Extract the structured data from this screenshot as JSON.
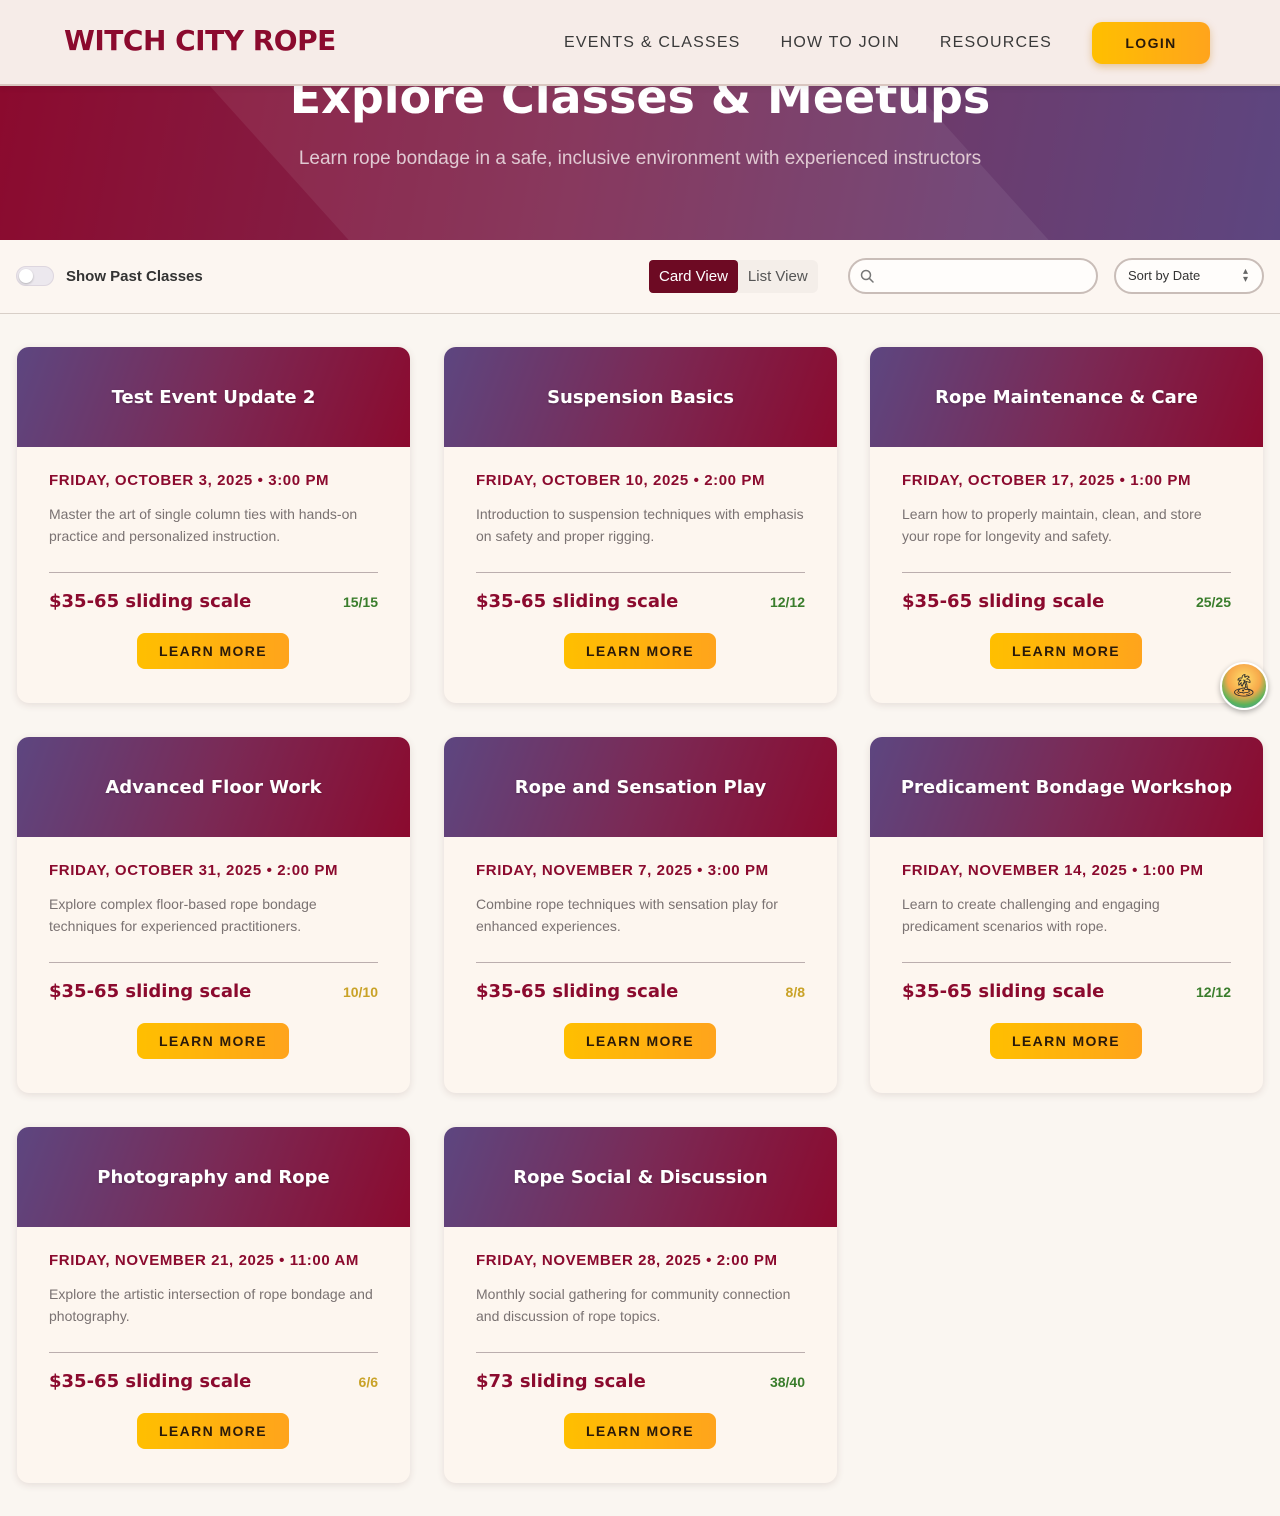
{
  "header": {
    "logo": "WITCH CITY ROPE",
    "nav": [
      "EVENTS & CLASSES",
      "HOW TO JOIN",
      "RESOURCES"
    ],
    "login_label": "LOGIN"
  },
  "hero": {
    "title": "Explore Classes & Meetups",
    "subtitle": "Learn rope bondage in a safe, inclusive environment with experienced instructors"
  },
  "filters": {
    "toggle_label": "Show Past Classes",
    "toggle_on": false,
    "card_view_label": "Card View",
    "list_view_label": "List View",
    "active_view": "Card View",
    "search_value": "",
    "sort_label": "Sort by Date"
  },
  "colors": {
    "brand": "#8b0a2e",
    "accent": "#ffbf00",
    "capacity_full": "#3a7d2c",
    "capacity_partial": "#c9a227"
  },
  "events": [
    {
      "title": "Test Event Update 2",
      "date": "FRIDAY, OCTOBER 3, 2025 • 3:00 PM",
      "description": "Master the art of single column ties with hands-on practice and personalized instruction.",
      "price": "$35-65 sliding scale",
      "capacity": "15/15",
      "capacity_color": "green",
      "button": "LEARN MORE"
    },
    {
      "title": "Suspension Basics",
      "date": "FRIDAY, OCTOBER 10, 2025 • 2:00 PM",
      "description": "Introduction to suspension techniques with emphasis on safety and proper rigging.",
      "price": "$35-65 sliding scale",
      "capacity": "12/12",
      "capacity_color": "green",
      "button": "LEARN MORE"
    },
    {
      "title": "Rope Maintenance & Care",
      "date": "FRIDAY, OCTOBER 17, 2025 • 1:00 PM",
      "description": "Learn how to properly maintain, clean, and store your rope for longevity and safety.",
      "price": "$35-65 sliding scale",
      "capacity": "25/25",
      "capacity_color": "green",
      "button": "LEARN MORE"
    },
    {
      "title": "Advanced Floor Work",
      "date": "FRIDAY, OCTOBER 31, 2025 • 2:00 PM",
      "description": "Explore complex floor-based rope bondage techniques for experienced practitioners.",
      "price": "$35-65 sliding scale",
      "capacity": "10/10",
      "capacity_color": "gold",
      "button": "LEARN MORE"
    },
    {
      "title": "Rope and Sensation Play",
      "date": "FRIDAY, NOVEMBER 7, 2025 • 3:00 PM",
      "description": "Combine rope techniques with sensation play for enhanced experiences.",
      "price": "$35-65 sliding scale",
      "capacity": "8/8",
      "capacity_color": "gold",
      "button": "LEARN MORE"
    },
    {
      "title": "Predicament Bondage Workshop",
      "date": "FRIDAY, NOVEMBER 14, 2025 • 1:00 PM",
      "description": "Learn to create challenging and engaging predicament scenarios with rope.",
      "price": "$35-65 sliding scale",
      "capacity": "12/12",
      "capacity_color": "green",
      "button": "LEARN MORE"
    },
    {
      "title": "Photography and Rope",
      "date": "FRIDAY, NOVEMBER 21, 2025 • 11:00 AM",
      "description": "Explore the artistic intersection of rope bondage and photography.",
      "price": "$35-65 sliding scale",
      "capacity": "6/6",
      "capacity_color": "gold",
      "button": "LEARN MORE"
    },
    {
      "title": "Rope Social & Discussion",
      "date": "FRIDAY, NOVEMBER 28, 2025 • 2:00 PM",
      "description": "Monthly social gathering for community connection and discussion of rope topics.",
      "price": "$73 sliding scale",
      "capacity": "38/40",
      "capacity_color": "green",
      "button": "LEARN MORE"
    }
  ],
  "floating_badge": {
    "icon": "beach-island-icon"
  }
}
